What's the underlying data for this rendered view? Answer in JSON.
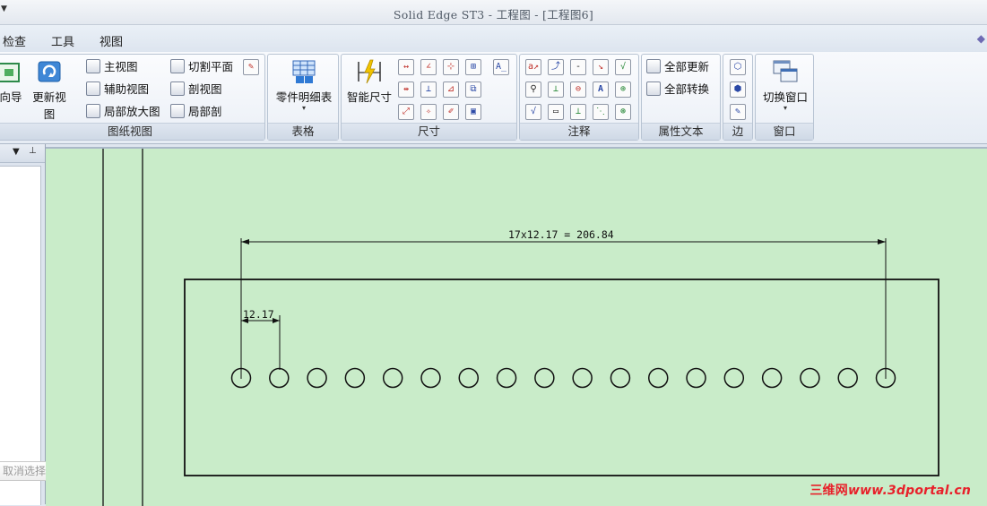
{
  "window": {
    "title": "Solid Edge ST3 - 工程图 - [工程图6]"
  },
  "menu": {
    "items": [
      "检查",
      "工具",
      "视图"
    ]
  },
  "ribbon": {
    "drawing_views": {
      "label": "图纸视图",
      "wizard_label": "向导",
      "update_views_label": "更新视图",
      "main_view": "主视图",
      "aux_view": "辅助视图",
      "detail_view": "局部放大图",
      "cutting_plane": "切割平面",
      "section_view": "剖视图",
      "broken_out": "局部剖"
    },
    "table": {
      "label": "表格",
      "parts_list": "零件明细表"
    },
    "dimension": {
      "label": "尺寸",
      "smart_dimension": "智能尺寸"
    },
    "annotation": {
      "label": "注释"
    },
    "property_text": {
      "label": "属性文本",
      "update_all": "全部更新",
      "convert_all": "全部转换"
    },
    "edge": {
      "label": "边"
    },
    "window_group": {
      "label": "窗口",
      "switch_window": "切换窗口"
    }
  },
  "left_panel": {
    "cancel_selection_label": "取消选择"
  },
  "drawing": {
    "overall_dimension": "17x12.17 = 206.84",
    "pitch_dimension": "12.17",
    "hole_count": 18
  },
  "watermark": {
    "brand": "三维网",
    "url": "www.3dportal.cn"
  },
  "colors": {
    "canvas": "#c9ecc9",
    "watermark": "#e8202a"
  }
}
